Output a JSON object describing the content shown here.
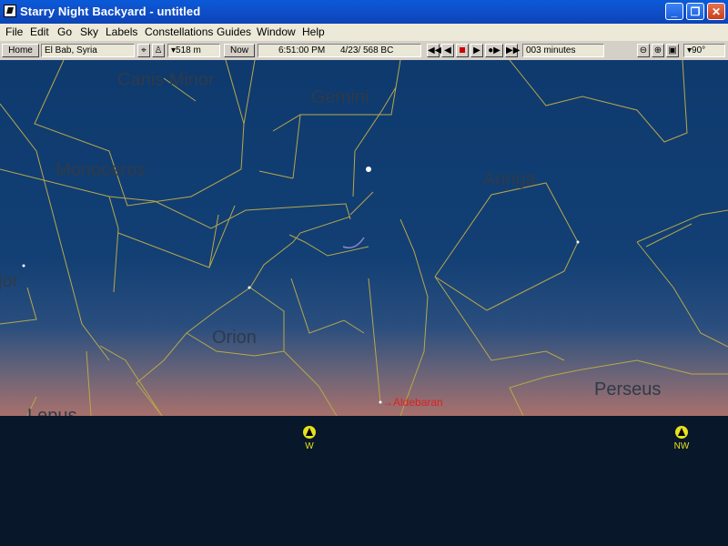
{
  "window": {
    "title": "Starry Night Backyard - untitled",
    "buttons": {
      "minimize": "_",
      "maximize": "❐",
      "close": "✕"
    }
  },
  "menu": [
    "File",
    "Edit",
    "Go",
    "Sky",
    "Labels",
    "Constellations",
    "Guides",
    "Window",
    "Help"
  ],
  "toolbar": {
    "home_label": "Home",
    "location": "El Bab, Syria",
    "elevation": "▾518 m",
    "now_label": "Now",
    "time": "6:51:00 PM",
    "date": "4/23/  568 BC",
    "time_step": "003 minutes",
    "fov": "▾90°"
  },
  "sky": {
    "constellations": [
      "Canis Minor",
      "Gemini",
      "Monoceros",
      "Auriga",
      "Orion",
      "Perseus",
      "Lepus",
      "jor"
    ],
    "stars": [
      "Aldebaran"
    ]
  },
  "compass": [
    "W",
    "NW"
  ],
  "colors": {
    "sky_top": "#0e3a6e",
    "sky_horizon": "#b5786e",
    "ground": "#08172a",
    "constellation_line": "#b8a84a",
    "label": "#2e3b4a",
    "star_label": "#e02020"
  }
}
